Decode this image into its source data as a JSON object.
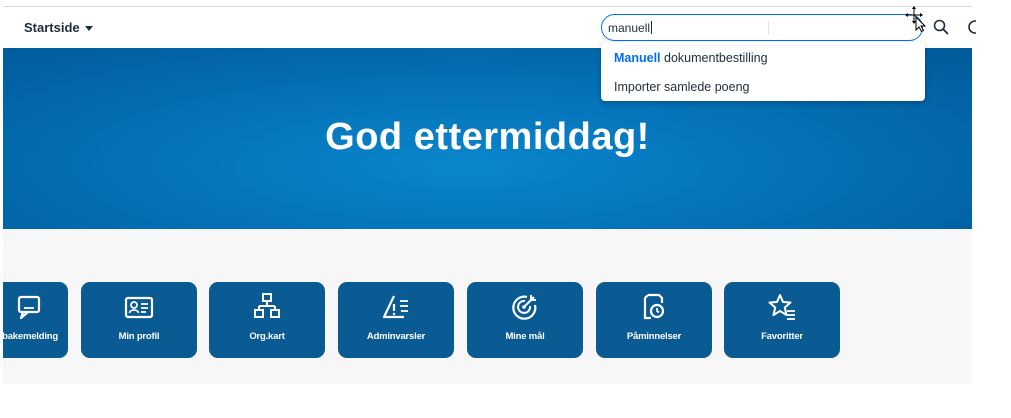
{
  "header": {
    "home_label": "Startside",
    "search_value": "manuell"
  },
  "search_suggestions": [
    {
      "highlight": "Manuell",
      "rest": " dokumentbestilling"
    },
    {
      "highlight": "",
      "rest": "Importer samlede poeng"
    }
  ],
  "hero": {
    "greeting": "God ettermiddag!"
  },
  "tiles": [
    {
      "label": "bakemelding",
      "icon": "feedback-icon"
    },
    {
      "label": "Min profil",
      "icon": "profile-card-icon"
    },
    {
      "label": "Org.kart",
      "icon": "org-chart-icon"
    },
    {
      "label": "Adminvarsler",
      "icon": "admin-alert-icon"
    },
    {
      "label": "Mine mål",
      "icon": "target-icon"
    },
    {
      "label": "Påminnelser",
      "icon": "reminder-icon"
    },
    {
      "label": "Favoritter",
      "icon": "favorite-star-icon"
    }
  ],
  "colors": {
    "hero": "#0572b8",
    "tile": "#0a5a93",
    "accent": "#0070f2"
  }
}
